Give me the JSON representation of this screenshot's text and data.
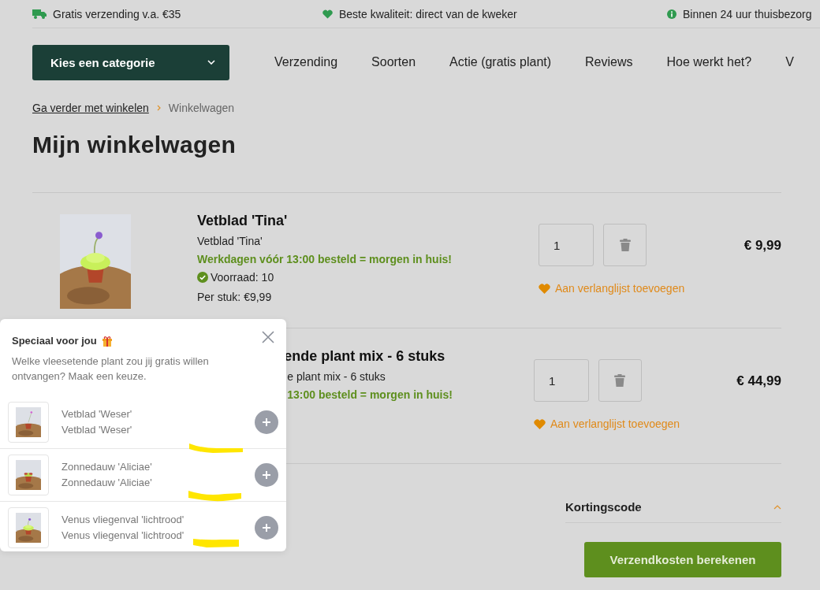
{
  "usp_bar": [
    {
      "kind": "truck",
      "text": "Gratis verzending v.a. €35"
    },
    {
      "kind": "heart",
      "text": "Beste kwaliteit: direct van de kweker"
    },
    {
      "kind": "info",
      "text": "Binnen 24 uur thuisbezorg"
    }
  ],
  "category_button": {
    "label": "Kies een categorie"
  },
  "nav": [
    "Verzending",
    "Soorten",
    "Actie (gratis plant)",
    "Reviews",
    "Hoe werkt het?",
    "V"
  ],
  "breadcrumb": [
    {
      "kind": "link",
      "label": "Ga verder met winkelen"
    },
    {
      "kind": "current",
      "label": "Winkelwagen"
    }
  ],
  "title": "Mijn winkelwagen",
  "cart_items": [
    {
      "covered": false,
      "name": "Vetblad 'Tina'",
      "subtitle": "Vetblad 'Tina'",
      "delivery": "Werkdagen vóór 13:00 besteld = morgen in huis!",
      "stock": "Voorraad: 10",
      "unit_price": "Per stuk: €9,99",
      "quantity": "1",
      "price": "€ 9,99",
      "wishlist": "Aan verlanglijst toevoegen"
    },
    {
      "covered": true,
      "name": "ende plant mix - 6 stuks",
      "subtitle": "e plant mix - 6 stuks",
      "delivery": "13:00 besteld = morgen in huis!",
      "quantity": "1",
      "price": "€ 44,99",
      "wishlist": "Aan verlanglijst toevoegen"
    }
  ],
  "discount": {
    "label": "Kortingscode",
    "expanded": true
  },
  "shipping_button": {
    "label": "Verzendkosten berekenen"
  },
  "gift_popup": {
    "title": "Speciaal voor jou",
    "description": "Welke vleesetende plant zou jij gratis willen ontvangen? Maak een keuze.",
    "options": [
      {
        "name": "Vetblad 'Weser'",
        "subtitle": "Vetblad 'Weser'"
      },
      {
        "name": "Zonnedauw 'Aliciae'",
        "subtitle": "Zonnedauw 'Aliciae'"
      },
      {
        "name": "Venus vliegenval 'lichtrood'",
        "subtitle": "Venus vliegenval 'lichtrood'"
      }
    ]
  }
}
